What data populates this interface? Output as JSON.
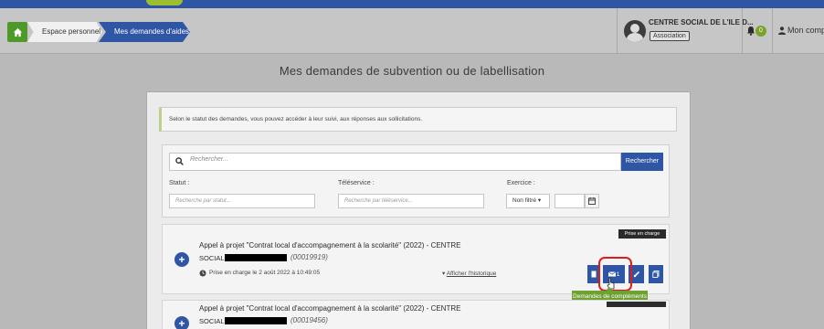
{
  "colors": {
    "accent": "#2f55a5",
    "success": "#6fa032",
    "highlight": "#e01b1b"
  },
  "breadcrumb": {
    "home_icon": "home-icon",
    "items": [
      "Espace personnel",
      "Mes demandes d'aides"
    ]
  },
  "header": {
    "organization": {
      "name": "CENTRE SOCIAL DE L'ILE D...",
      "badge": "Association",
      "avatar_icon": "org-avatar"
    },
    "notifications": {
      "icon": "bell-icon",
      "count": "0"
    },
    "account": {
      "icon": "user-icon",
      "label": "Mon comp"
    }
  },
  "page": {
    "title": "Mes demandes de subvention ou de labellisation",
    "info": "Selon le statut des demandes, vous pouvez accéder à leur suivi, aux réponses aux sollicitations."
  },
  "filters": {
    "search": {
      "placeholder": "Rechercher...",
      "button": "Rechercher"
    },
    "status": {
      "label": "Statut :",
      "placeholder": "Recherche par statut..."
    },
    "teleservice": {
      "label": "Téléservice :",
      "placeholder": "Recherche par téléservice..."
    },
    "exercise": {
      "label": "Exercice :",
      "select": "Non filtré ▾"
    }
  },
  "requests": [
    {
      "title_line1": "Appel à projet \"Contrat local d'accompagnement à la scolarité\" (2022) - CENTRE",
      "title_line2": "SOCIAL",
      "reference": "(00019919)",
      "status": "Prise en charge",
      "taken_charge": "Prise en charge le 2 août 2022 à 10:49:05",
      "history_link": "Afficher l'historique",
      "actions": [
        "document-icon",
        "message-icon",
        "link-icon",
        "copy-icon"
      ],
      "message_count": "1",
      "tooltip": "Demandes de compléments"
    },
    {
      "title_line1": "Appel à projet \"Contrat local d'accompagnement à la scolarité\" (2022) - CENTRE",
      "title_line2": "SOCIAL",
      "reference": "(00019456)"
    }
  ]
}
